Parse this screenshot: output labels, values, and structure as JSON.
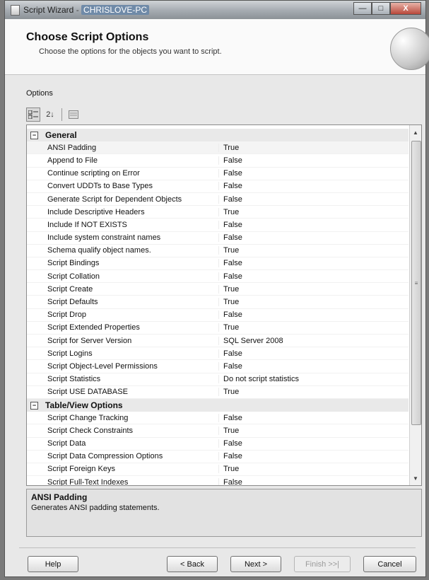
{
  "window": {
    "title_prefix": "Script Wizard",
    "title_separator": "-",
    "machine": "CHRISLOVE-PC",
    "controls": {
      "minimize": "—",
      "maximize": "□",
      "close": "X"
    }
  },
  "header": {
    "title": "Choose Script Options",
    "subtitle": "Choose the options for the objects you want to script."
  },
  "options_label": "Options",
  "toolbar": {
    "categorized_icon": "categorized-icon",
    "alphabetical_label": "2↓",
    "property_pages_icon": "property-pages-icon"
  },
  "grid": {
    "categories": [
      {
        "name": "General",
        "expanded_glyph": "−",
        "rows": [
          {
            "name": "ANSI Padding",
            "value": "True"
          },
          {
            "name": "Append to File",
            "value": "False"
          },
          {
            "name": "Continue scripting on Error",
            "value": "False"
          },
          {
            "name": "Convert UDDTs to Base Types",
            "value": "False"
          },
          {
            "name": "Generate Script for Dependent Objects",
            "value": "False"
          },
          {
            "name": "Include Descriptive Headers",
            "value": "True"
          },
          {
            "name": "Include If NOT EXISTS",
            "value": "False"
          },
          {
            "name": "Include system constraint names",
            "value": "False"
          },
          {
            "name": "Schema qualify object names.",
            "value": "True"
          },
          {
            "name": "Script Bindings",
            "value": "False"
          },
          {
            "name": "Script Collation",
            "value": "False"
          },
          {
            "name": "Script Create",
            "value": "True"
          },
          {
            "name": "Script Defaults",
            "value": "True"
          },
          {
            "name": "Script Drop",
            "value": "False"
          },
          {
            "name": "Script Extended Properties",
            "value": "True"
          },
          {
            "name": "Script for Server Version",
            "value": "SQL Server 2008"
          },
          {
            "name": "Script Logins",
            "value": "False"
          },
          {
            "name": "Script Object-Level Permissions",
            "value": "False"
          },
          {
            "name": "Script Statistics",
            "value": "Do not script statistics"
          },
          {
            "name": "Script USE DATABASE",
            "value": "True"
          }
        ]
      },
      {
        "name": "Table/View Options",
        "expanded_glyph": "−",
        "rows": [
          {
            "name": "Script Change Tracking",
            "value": "False"
          },
          {
            "name": "Script Check Constraints",
            "value": "True"
          },
          {
            "name": "Script Data",
            "value": "False"
          },
          {
            "name": "Script Data Compression Options",
            "value": "False"
          },
          {
            "name": "Script Foreign Keys",
            "value": "True"
          },
          {
            "name": "Script Full-Text Indexes",
            "value": "False"
          }
        ]
      }
    ],
    "selected": "ANSI Padding"
  },
  "description": {
    "title": "ANSI Padding",
    "text": "Generates ANSI padding statements."
  },
  "buttons": {
    "help": "Help",
    "back": "< Back",
    "next": "Next >",
    "finish": "Finish >>|",
    "cancel": "Cancel"
  }
}
